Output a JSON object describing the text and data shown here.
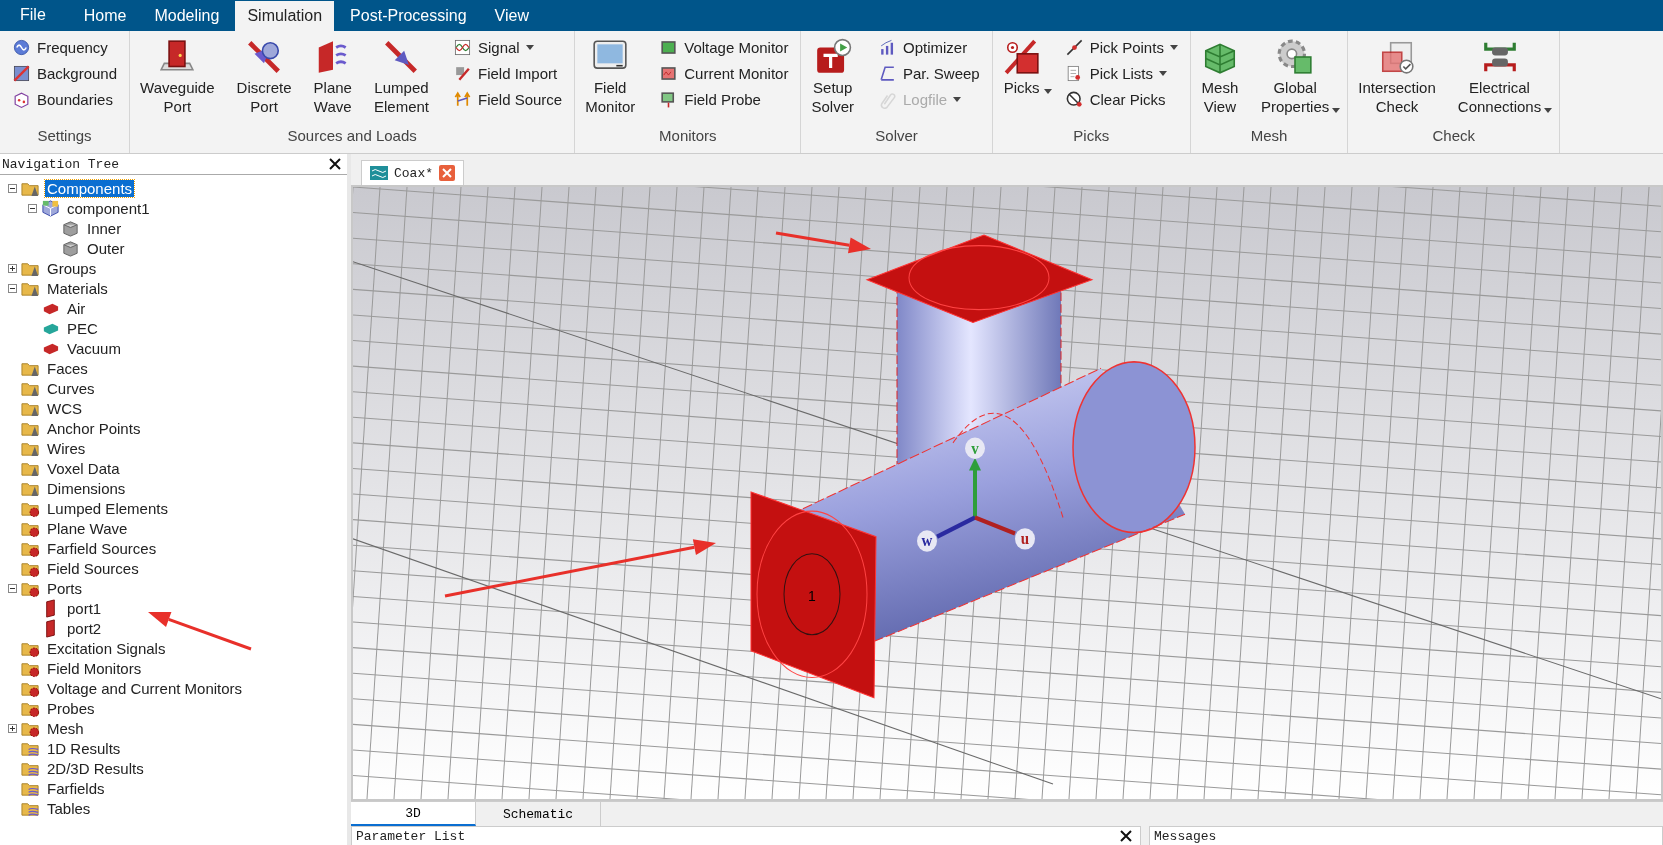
{
  "file_menu": "File",
  "menu_tabs": [
    {
      "label": "Home",
      "selected": false
    },
    {
      "label": "Modeling",
      "selected": false
    },
    {
      "label": "Simulation",
      "selected": true
    },
    {
      "label": "Post-Processing",
      "selected": false
    },
    {
      "label": "View",
      "selected": false
    }
  ],
  "ribbon_groups": [
    {
      "title": "Settings",
      "items": [
        {
          "kind": "small",
          "label": "Frequency"
        },
        {
          "kind": "small",
          "label": "Background"
        },
        {
          "kind": "small",
          "label": "Boundaries"
        }
      ]
    },
    {
      "title": "Sources and Loads",
      "items": [
        {
          "kind": "large",
          "label": "Waveguide Port"
        },
        {
          "kind": "large",
          "label": "Discrete Port"
        },
        {
          "kind": "large",
          "label": "Plane Wave"
        },
        {
          "kind": "large",
          "label": "Lumped Element"
        },
        {
          "kind": "small",
          "label": "Signal",
          "dropdown": true
        },
        {
          "kind": "small",
          "label": "Field Import"
        },
        {
          "kind": "small",
          "label": "Field Source"
        }
      ]
    },
    {
      "title": "Monitors",
      "items": [
        {
          "kind": "large",
          "label": "Field Monitor"
        },
        {
          "kind": "small",
          "label": "Voltage Monitor"
        },
        {
          "kind": "small",
          "label": "Current Monitor"
        },
        {
          "kind": "small",
          "label": "Field Probe"
        }
      ]
    },
    {
      "title": "Solver",
      "items": [
        {
          "kind": "large",
          "label": "Setup Solver"
        },
        {
          "kind": "small",
          "label": "Optimizer"
        },
        {
          "kind": "small",
          "label": "Par. Sweep"
        },
        {
          "kind": "small",
          "label": "Logfile",
          "dropdown": true,
          "disabled": true
        }
      ]
    },
    {
      "title": "Picks",
      "items": [
        {
          "kind": "large",
          "label": "Picks",
          "dropdown": true
        },
        {
          "kind": "small",
          "label": "Pick Points",
          "dropdown": true
        },
        {
          "kind": "small",
          "label": "Pick Lists",
          "dropdown": true
        },
        {
          "kind": "small",
          "label": "Clear Picks"
        }
      ]
    },
    {
      "title": "Mesh",
      "items": [
        {
          "kind": "large",
          "label": "Mesh View"
        },
        {
          "kind": "large",
          "label": "Global Properties",
          "dropdown": true
        }
      ]
    },
    {
      "title": "Check",
      "items": [
        {
          "kind": "large",
          "label": "Intersection Check"
        },
        {
          "kind": "large",
          "label": "Electrical Connections",
          "dropdown": true
        }
      ]
    }
  ],
  "navigation_tree": {
    "title": "Navigation Tree",
    "nodes": [
      {
        "label": "Components",
        "kind": "folder",
        "expanded": true,
        "selected": true,
        "children": [
          {
            "label": "component1",
            "kind": "component",
            "expanded": true,
            "selected": false,
            "children": [
              {
                "label": "Inner",
                "kind": "solid",
                "selected": false
              },
              {
                "label": "Outer",
                "kind": "solid",
                "selected": false
              }
            ]
          }
        ]
      },
      {
        "label": "Groups",
        "kind": "folder",
        "expanded": false,
        "selected": false
      },
      {
        "label": "Materials",
        "kind": "folder",
        "expanded": true,
        "selected": false,
        "children": [
          {
            "label": "Air",
            "kind": "material",
            "color": "#c62828",
            "selected": false
          },
          {
            "label": "PEC",
            "kind": "material",
            "color": "#26a69a",
            "selected": false
          },
          {
            "label": "Vacuum",
            "kind": "material",
            "color": "#c62828",
            "selected": false
          }
        ]
      },
      {
        "label": "Faces",
        "kind": "folder",
        "selected": false
      },
      {
        "label": "Curves",
        "kind": "folder",
        "selected": false
      },
      {
        "label": "WCS",
        "kind": "folder",
        "selected": false
      },
      {
        "label": "Anchor Points",
        "kind": "folder",
        "selected": false
      },
      {
        "label": "Wires",
        "kind": "folder",
        "selected": false
      },
      {
        "label": "Voxel Data",
        "kind": "folder",
        "selected": false
      },
      {
        "label": "Dimensions",
        "kind": "folder",
        "selected": false
      },
      {
        "label": "Lumped Elements",
        "kind": "source",
        "selected": false
      },
      {
        "label": "Plane Wave",
        "kind": "source",
        "selected": false
      },
      {
        "label": "Farfield Sources",
        "kind": "source",
        "selected": false
      },
      {
        "label": "Field Sources",
        "kind": "source",
        "selected": false
      },
      {
        "label": "Ports",
        "kind": "source",
        "expanded": true,
        "selected": false,
        "children": [
          {
            "label": "port1",
            "kind": "port",
            "selected": false
          },
          {
            "label": "port2",
            "kind": "port",
            "selected": false
          }
        ]
      },
      {
        "label": "Excitation Signals",
        "kind": "source",
        "selected": false
      },
      {
        "label": "Field Monitors",
        "kind": "source",
        "selected": false
      },
      {
        "label": "Voltage and Current Monitors",
        "kind": "source",
        "selected": false
      },
      {
        "label": "Probes",
        "kind": "source",
        "selected": false
      },
      {
        "label": "Mesh",
        "kind": "source",
        "expanded": false,
        "selected": false
      },
      {
        "label": "1D Results",
        "kind": "result",
        "selected": false
      },
      {
        "label": "2D/3D Results",
        "kind": "result",
        "selected": false
      },
      {
        "label": "Farfields",
        "kind": "result",
        "selected": false
      },
      {
        "label": "Tables",
        "kind": "result",
        "selected": false
      }
    ]
  },
  "document_tab": {
    "label": "Coax*"
  },
  "viewport": {
    "axis_labels": [
      "v",
      "w",
      "u"
    ],
    "port_label": "1"
  },
  "view_tabs": [
    {
      "label": "3D",
      "selected": true
    },
    {
      "label": "Schematic",
      "selected": false
    }
  ],
  "bottom_panels": [
    {
      "title": "Parameter List",
      "closable": true
    },
    {
      "title": "Messages",
      "closable": false
    }
  ]
}
